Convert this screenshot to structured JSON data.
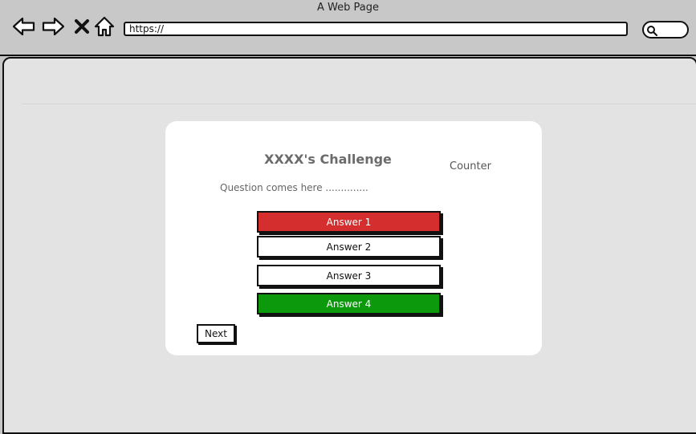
{
  "window": {
    "title": "A Web Page"
  },
  "address_bar": {
    "value": "https://"
  },
  "toolbar_icons": [
    "back-arrow-icon",
    "forward-arrow-icon",
    "close-x-icon",
    "home-icon",
    "search-icon"
  ],
  "quiz": {
    "title": "XXXX's Challenge",
    "counter_label": "Counter",
    "question": "Question comes here ..............",
    "answers": [
      "Answer 1",
      "Answer 2",
      "Answer 3",
      "Answer 4"
    ],
    "next_label": "Next"
  },
  "colors": {
    "chrome_bg": "#c8c8c8",
    "viewport_bg": "#e3e3e3",
    "card_bg": "#ffffff",
    "incorrect": "#d42e2e",
    "correct": "#0c990c"
  }
}
